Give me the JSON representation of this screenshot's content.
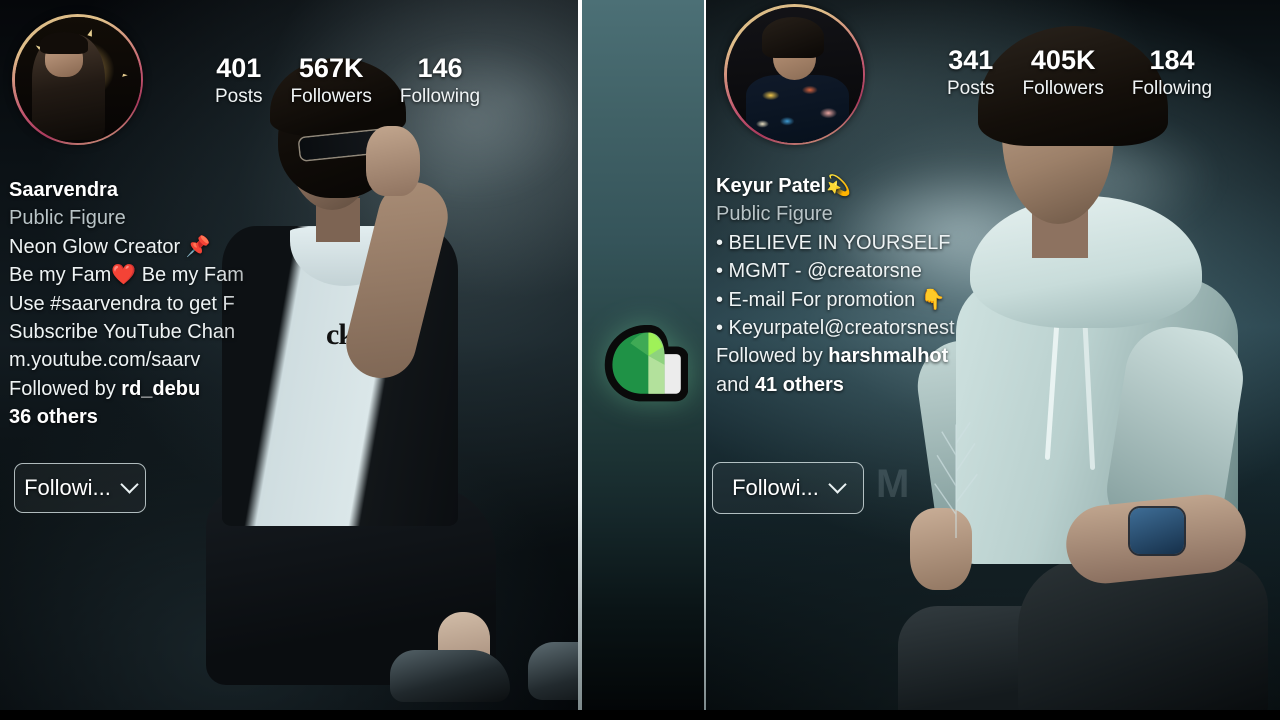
{
  "center": {
    "app_icon": "snapseed-logo"
  },
  "watermarks": {
    "top_right": "",
    "middle": "M"
  },
  "left_profile": {
    "avatar": "profile-photo-neon-star",
    "stats": [
      {
        "value": "401",
        "label": "Posts"
      },
      {
        "value": "567K",
        "label": "Followers"
      },
      {
        "value": "146",
        "label": "Following"
      }
    ],
    "name": "Saarvendra",
    "category": "Public Figure",
    "bio_lines": [
      "Neon Glow Creator 📌",
      "Be my Fam❤️ Be my Fam",
      "Use #saarvendra to get F",
      "Subscribe YouTube Chan",
      "m.youtube.com/saarv"
    ],
    "followed_by_prefix": "Followed by ",
    "followed_by_user": "rd_debu",
    "followed_by_others": "36 others",
    "follow_button_label": "Followi...",
    "follow_button_icon": "chevron-down-icon"
  },
  "right_profile": {
    "avatar": "profile-photo-floral-shirt",
    "stats": [
      {
        "value": "341",
        "label": "Posts"
      },
      {
        "value": "405K",
        "label": "Followers"
      },
      {
        "value": "184",
        "label": "Following"
      }
    ],
    "name": "Keyur Patel💫",
    "category": "Public Figure",
    "bio_lines": [
      "• BELIEVE IN YOURSELF",
      "• MGMT - @creatorsne",
      "• E-mail For promotion 👇",
      "• Keyurpatel@creatorsnest"
    ],
    "followed_by_prefix": "Followed by ",
    "followed_by_user": "harshmalhot",
    "followed_by_others_prefix": "and ",
    "followed_by_others": "41 others",
    "follow_button_label": "Followi...",
    "follow_button_icon": "chevron-down-icon"
  },
  "colors": {
    "strip_top": "#4c7076",
    "strip_bottom": "#030607",
    "avatar_ring": "#c2566f",
    "text_primary": "#ffffff",
    "text_secondary": "#b9c4c7"
  }
}
